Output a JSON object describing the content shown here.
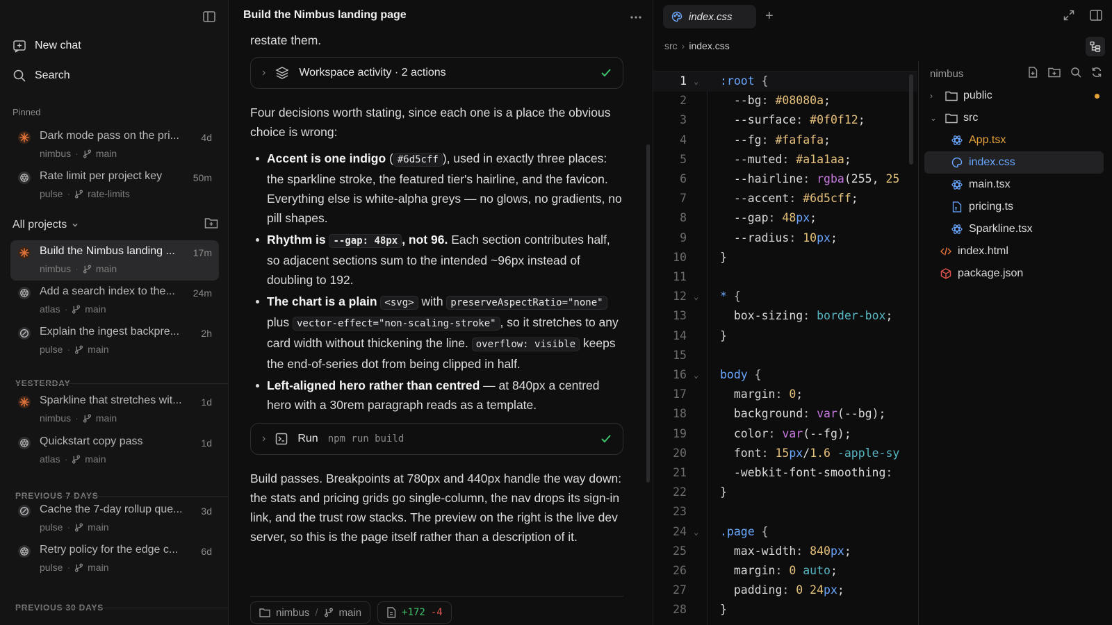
{
  "sidebar": {
    "new_chat": "New chat",
    "search": "Search",
    "pinned_label": "Pinned",
    "all_projects": "All projects",
    "yesterday": "YESTERDAY",
    "prev7": "PREVIOUS 7 DAYS",
    "prev30": "PREVIOUS 30 DAYS",
    "chats": [
      {
        "title": "Dark mode pass on the pri...",
        "age": "4d",
        "project": "nimbus",
        "branch": "main",
        "icon": "claude-icon"
      },
      {
        "title": "Rate limit per project key",
        "age": "50m",
        "project": "pulse",
        "branch": "rate-limits",
        "icon": "openai-icon"
      },
      {
        "title": "Build the Nimbus landing ...",
        "age": "17m",
        "project": "nimbus",
        "branch": "main",
        "icon": "claude-icon"
      },
      {
        "title": "Add a search index to the...",
        "age": "24m",
        "project": "atlas",
        "branch": "main",
        "icon": "openai-icon"
      },
      {
        "title": "Explain the ingest backpre...",
        "age": "2h",
        "project": "pulse",
        "branch": "main",
        "icon": "slash-circle-icon"
      },
      {
        "title": "Sparkline that stretches wit...",
        "age": "1d",
        "project": "nimbus",
        "branch": "main",
        "icon": "claude-icon"
      },
      {
        "title": "Quickstart copy pass",
        "age": "1d",
        "project": "atlas",
        "branch": "main",
        "icon": "openai-icon"
      },
      {
        "title": "Cache the 7-day rollup que...",
        "age": "3d",
        "project": "pulse",
        "branch": "main",
        "icon": "slash-circle-icon"
      },
      {
        "title": "Retry policy for the edge c...",
        "age": "6d",
        "project": "pulse",
        "branch": "main",
        "icon": "openai-icon"
      }
    ]
  },
  "chat": {
    "title": "Build the Nimbus landing page",
    "intro_tail": "restate them.",
    "activity_label": "Workspace activity · 2 actions",
    "decisions_intro": "Four decisions worth stating, since each one is a place the obvious choice is wrong:",
    "b1_bold": "Accent is one indigo",
    "b1_pre": " (",
    "b1_code": "#6d5cff",
    "b1_text": "), used in exactly three places: the sparkline stroke, the featured tier's hairline, and the favicon. Everything else is white-alpha greys — no glows, no gradients, no pill shapes.",
    "b2_bold1": "Rhythm is",
    "b2_code": "--gap: 48px",
    "b2_bold2": ", not 96.",
    "b2_text": " Each section contributes half, so adjacent sections sum to the intended ~96px instead of doubling to 192.",
    "b3_bold": "The chart is a plain",
    "b3_code1": "<svg>",
    "b3_t1": " with ",
    "b3_code2": "preserveAspectRatio=\"none\"",
    "b3_t2": " plus ",
    "b3_code3": "vector-effect=\"non-scaling-stroke\"",
    "b3_t3": ", so it stretches to any card width without thickening the line. ",
    "b3_code4": "overflow: visible",
    "b3_t4": " keeps the end-of-series dot from being clipped in half.",
    "b4_bold": "Left-aligned hero rather than centred",
    "b4_text": " — at 840px a centred hero with a 30rem paragraph reads as a template.",
    "run_label": "Run",
    "run_cmd": "npm run build",
    "outro": "Build passes. Breakpoints at 780px and 440px handle the way down: the stats and pricing grids go single-column, the nav drops its sign-in link, and the trust row stacks. The preview on the right is the live dev server, so this is the page itself rather than a description of it.",
    "footer": {
      "project": "nimbus",
      "sep": "/",
      "branch": "main",
      "added": "+172",
      "removed": "-4"
    }
  },
  "editor": {
    "tab": "index.css",
    "crumb": [
      "src",
      "index.css"
    ],
    "files_root": "nimbus",
    "files": [
      {
        "name": "public",
        "kind": "folder",
        "open": false,
        "modified": true
      },
      {
        "name": "src",
        "kind": "folder",
        "open": true
      },
      {
        "name": "App.tsx",
        "kind": "react",
        "modified": true
      },
      {
        "name": "index.css",
        "kind": "css",
        "selected": true
      },
      {
        "name": "main.tsx",
        "kind": "react"
      },
      {
        "name": "pricing.ts",
        "kind": "ts"
      },
      {
        "name": "Sparkline.tsx",
        "kind": "react"
      },
      {
        "name": "index.html",
        "kind": "html"
      },
      {
        "name": "package.json",
        "kind": "json"
      }
    ],
    "lines": [
      ":root {",
      "  --bg: #08080a;",
      "  --surface: #0f0f12;",
      "  --fg: #fafafa;",
      "  --muted: #a1a1aa;",
      "  --hairline: rgba(255, 25",
      "  --accent: #6d5cff;",
      "  --gap: 48px;",
      "  --radius: 10px;",
      "}",
      "",
      "* {",
      "  box-sizing: border-box;",
      "}",
      "",
      "body {",
      "  margin: 0;",
      "  background: var(--bg);",
      "  color: var(--fg);",
      "  font: 15px/1.6 -apple-sy",
      "  -webkit-font-smoothing:",
      "}",
      "",
      ".page {",
      "  max-width: 840px;",
      "  margin: 0 auto;",
      "  padding: 0 24px;",
      "}"
    ]
  },
  "colors": {
    "accent": "#6d5cff",
    "green": "#3ec26b",
    "red": "#e0564d",
    "claude": "#e0733a",
    "modified": "#e5a33a",
    "react": "#6aa7ff"
  }
}
